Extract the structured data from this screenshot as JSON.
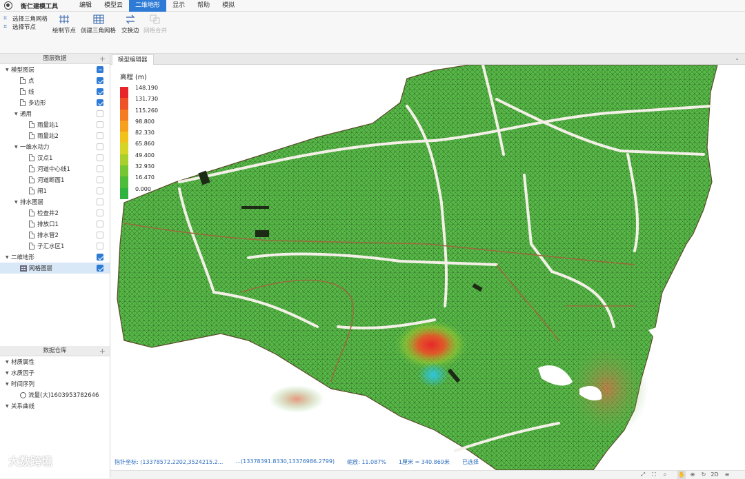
{
  "app": {
    "title": "衡仁建模工具"
  },
  "menu": {
    "tabs": [
      "编辑",
      "模型云",
      "二维地形",
      "显示",
      "帮助",
      "模拟"
    ],
    "active_index": 2
  },
  "ribbon": {
    "select_triangle_mesh": "选择三角网格",
    "select_nodes": "选择节点",
    "draw_nodes": "绘制节点",
    "create_triangle_mesh": "创建三角网格",
    "swap_edge": "交换边",
    "mesh_merge": "网格合并"
  },
  "layer_panel": {
    "header": "图层数据",
    "items": [
      {
        "label": "模型图层",
        "level": 0,
        "caret": "▼",
        "icon": "none",
        "check": "partial"
      },
      {
        "label": "点",
        "level": 1,
        "caret": "",
        "icon": "doc",
        "check": "on"
      },
      {
        "label": "线",
        "level": 1,
        "caret": "",
        "icon": "doc",
        "check": "on"
      },
      {
        "label": "多边形",
        "level": 1,
        "caret": "",
        "icon": "doc",
        "check": "on"
      },
      {
        "label": "通用",
        "level": 1,
        "caret": "▼",
        "icon": "none",
        "check": "off"
      },
      {
        "label": "雨量站1",
        "level": 2,
        "caret": "",
        "icon": "doc",
        "check": "off"
      },
      {
        "label": "雨量站2",
        "level": 2,
        "caret": "",
        "icon": "doc",
        "check": "off"
      },
      {
        "label": "一维水动力",
        "level": 1,
        "caret": "▼",
        "icon": "none",
        "check": "off"
      },
      {
        "label": "汉点1",
        "level": 2,
        "caret": "",
        "icon": "doc",
        "check": "off"
      },
      {
        "label": "河道中心线1",
        "level": 2,
        "caret": "",
        "icon": "doc",
        "check": "off"
      },
      {
        "label": "河道断面1",
        "level": 2,
        "caret": "",
        "icon": "doc",
        "check": "off"
      },
      {
        "label": "闸1",
        "level": 2,
        "caret": "",
        "icon": "doc",
        "check": "off"
      },
      {
        "label": "排水图层",
        "level": 1,
        "caret": "▼",
        "icon": "none",
        "check": "off"
      },
      {
        "label": "检查井2",
        "level": 2,
        "caret": "",
        "icon": "doc",
        "check": "off"
      },
      {
        "label": "排放口1",
        "level": 2,
        "caret": "",
        "icon": "doc",
        "check": "off"
      },
      {
        "label": "排水管2",
        "level": 2,
        "caret": "",
        "icon": "doc",
        "check": "off"
      },
      {
        "label": "子汇水区1",
        "level": 2,
        "caret": "",
        "icon": "doc",
        "check": "off"
      },
      {
        "label": "二维地形",
        "level": 0,
        "caret": "▼",
        "icon": "none",
        "check": "on"
      },
      {
        "label": "网格图层",
        "level": 1,
        "caret": "",
        "icon": "grid",
        "check": "on",
        "selected": true
      }
    ]
  },
  "data_panel": {
    "header": "数据仓库",
    "items": [
      {
        "label": "材质属性",
        "level": 0,
        "caret": "▼",
        "icon": "none"
      },
      {
        "label": "水质因子",
        "level": 0,
        "caret": "▼",
        "icon": "none"
      },
      {
        "label": "时间序列",
        "level": 0,
        "caret": "▼",
        "icon": "none"
      },
      {
        "label": "流量(大)1603953782646",
        "level": 1,
        "caret": "",
        "icon": "clock"
      },
      {
        "label": "关系曲线",
        "level": 0,
        "caret": "▼",
        "icon": "none"
      }
    ]
  },
  "editor": {
    "tab": "模型编辑器"
  },
  "legend": {
    "title": "高程 (m)",
    "entries": [
      {
        "label": "148.190",
        "color": "#e8262a"
      },
      {
        "label": "131.730",
        "color": "#ee5226"
      },
      {
        "label": "115.260",
        "color": "#f47c22"
      },
      {
        "label": "98.800",
        "color": "#f6a01e"
      },
      {
        "label": "82.330",
        "color": "#f2c21c"
      },
      {
        "label": "65.860",
        "color": "#d6d426"
      },
      {
        "label": "49.400",
        "color": "#a8cf2c"
      },
      {
        "label": "32.930",
        "color": "#76c533"
      },
      {
        "label": "16.470",
        "color": "#4cbc39"
      },
      {
        "label": "0.000",
        "color": "#2fb33f"
      }
    ]
  },
  "status": {
    "pointer": "指针坐标: (13378572.2202,3524215.2...",
    "center": "...(13378391.8330,13376986.2799)",
    "zoom": "缩放: 11.087%",
    "scale": "1厘米 = 340.869米",
    "selected": "已选择"
  },
  "watermark": "大数跨境",
  "colors": {
    "accent": "#2e7bd6",
    "mesh_green": "#55b947",
    "road": "#f4f0e8"
  }
}
